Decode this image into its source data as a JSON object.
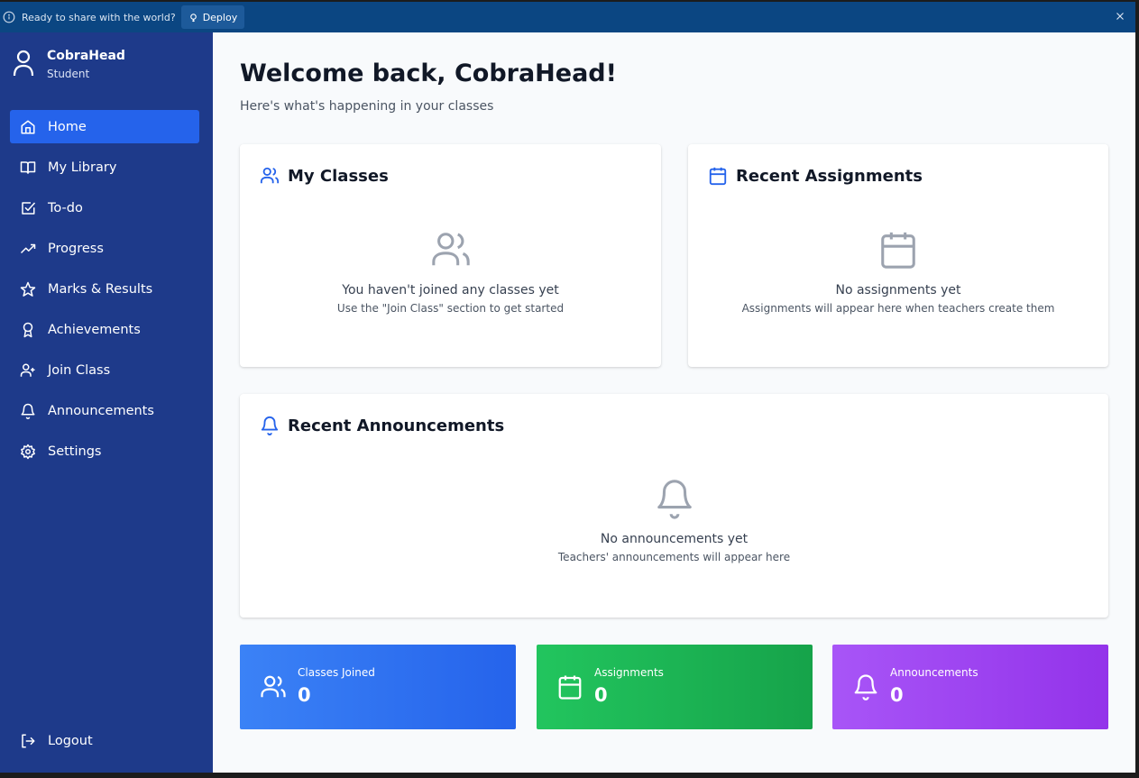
{
  "banner": {
    "message": "Ready to share with the world?",
    "deploy_label": "Deploy"
  },
  "user": {
    "name": "CobraHead",
    "role": "Student"
  },
  "nav": {
    "items": [
      {
        "label": "Home",
        "icon": "home-icon",
        "active": true
      },
      {
        "label": "My Library",
        "icon": "book-icon"
      },
      {
        "label": "To-do",
        "icon": "checkbox-icon"
      },
      {
        "label": "Progress",
        "icon": "trending-up-icon"
      },
      {
        "label": "Marks & Results",
        "icon": "star-icon"
      },
      {
        "label": "Achievements",
        "icon": "award-icon"
      },
      {
        "label": "Join Class",
        "icon": "user-plus-icon"
      },
      {
        "label": "Announcements",
        "icon": "bell-icon"
      },
      {
        "label": "Settings",
        "icon": "gear-icon"
      }
    ],
    "logout_label": "Logout"
  },
  "page": {
    "title": "Welcome back, CobraHead!",
    "subtitle": "Here's what's happening in your classes"
  },
  "cards": {
    "classes": {
      "title": "My Classes",
      "empty_title": "You haven't joined any classes yet",
      "empty_hint": "Use the \"Join Class\" section to get started"
    },
    "assignments": {
      "title": "Recent Assignments",
      "empty_title": "No assignments yet",
      "empty_hint": "Assignments will appear here when teachers create them"
    },
    "announcements": {
      "title": "Recent Announcements",
      "empty_title": "No announcements yet",
      "empty_hint": "Teachers' announcements will appear here"
    }
  },
  "stats": [
    {
      "label": "Classes Joined",
      "value": "0",
      "icon": "users-icon",
      "colors": [
        "#3b82f6",
        "#2563eb"
      ]
    },
    {
      "label": "Assignments",
      "value": "0",
      "icon": "calendar-icon",
      "colors": [
        "#22c55e",
        "#16a34a"
      ]
    },
    {
      "label": "Announcements",
      "value": "0",
      "icon": "bell-icon",
      "colors": [
        "#a855f7",
        "#9333ea"
      ]
    }
  ],
  "colors": {
    "sidebar": "#1e3a8a",
    "accent": "#2563eb",
    "banner": "#0b4682"
  }
}
